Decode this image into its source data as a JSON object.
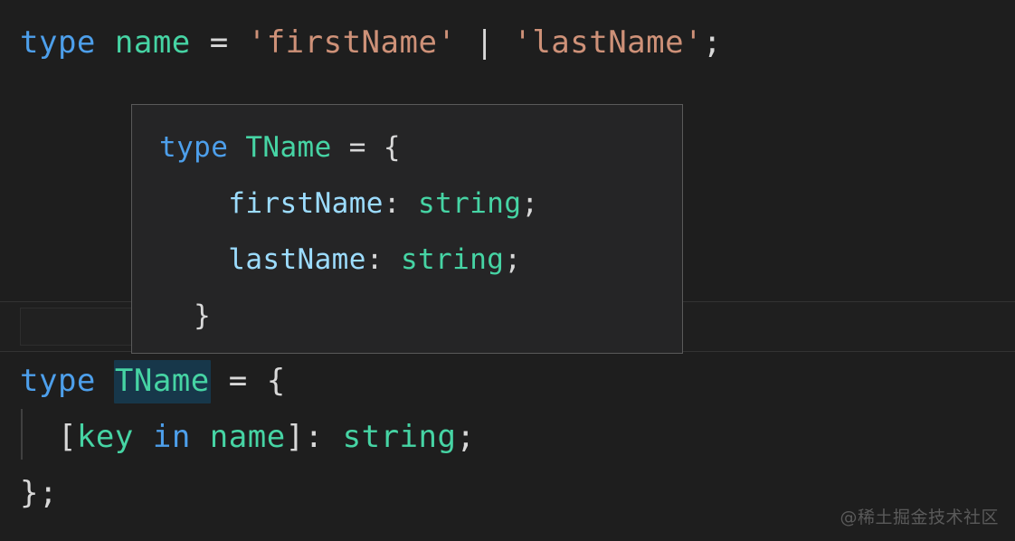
{
  "editor": {
    "background": "#1e1e1e",
    "colors": {
      "keyword": "#4d9feb",
      "type": "#46d4a4",
      "string": "#ce9178",
      "property": "#9cdcfe",
      "punctuation": "#d8d8d8",
      "word_highlight": "#17374a",
      "tooltip_bg": "#252526",
      "tooltip_border": "#5a5a5a",
      "current_line_bg": "#1f1f1f",
      "indent_guide": "#404040",
      "watermark": "#5a5a5a"
    }
  },
  "code": {
    "line1": {
      "keyword": "type",
      "space1": " ",
      "name": "name",
      "space2": " ",
      "equals": "=",
      "space3": " ",
      "string1": "'firstName'",
      "space4": " ",
      "pipe": "|",
      "space5": " ",
      "string2": "'lastName'",
      "semicolon": ";"
    },
    "line2": {
      "keyword": "type",
      "space1": " ",
      "typename": "TName",
      "space2": " ",
      "equals": "=",
      "space3": " ",
      "brace": "{"
    },
    "line3": {
      "indent": "  ",
      "bracket_open": "[",
      "key": "key",
      "space1": " ",
      "in_keyword": "in",
      "space2": " ",
      "name": "name",
      "bracket_close": "]",
      "colon": ":",
      "space3": " ",
      "string_type": "string",
      "semicolon": ";"
    },
    "line4": {
      "close": "};"
    }
  },
  "tooltip": {
    "line1": {
      "keyword": "type",
      "space1": " ",
      "typename": "TName",
      "space2": " ",
      "equals": "=",
      "space3": " ",
      "brace_open": "{"
    },
    "line2": {
      "indent": "    ",
      "property": "firstName",
      "colon": ":",
      "space": " ",
      "type": "string",
      "semicolon": ";"
    },
    "line3": {
      "indent": "    ",
      "property": "lastName",
      "colon": ":",
      "space": " ",
      "type": "string",
      "semicolon": ";"
    },
    "line4": {
      "indent": "  ",
      "brace_close": "}"
    }
  },
  "watermark": {
    "text": "@稀土掘金技术社区"
  }
}
